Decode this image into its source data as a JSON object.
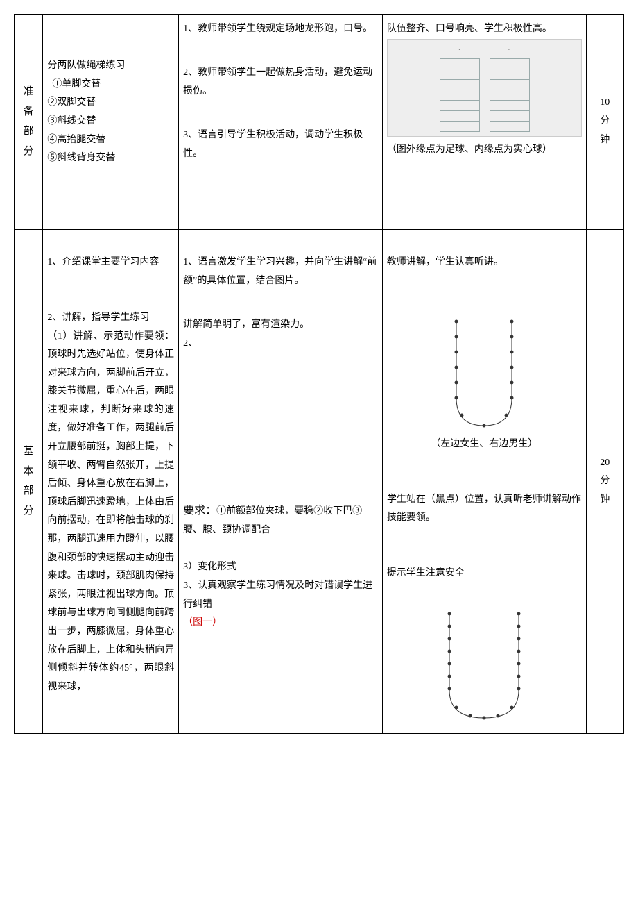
{
  "row1": {
    "label": "准备部分",
    "content_intro": "分两队做绳梯练习",
    "content_items": [
      "①单脚交替",
      "②双脚交替",
      "③斜线交替",
      "④高抬腿交替",
      "⑤斜线背身交替"
    ],
    "teacher": [
      "1、教师带领学生绕规定场地龙形跑，口号。",
      "2、教师带领学生一起做热身活动，避免运动损伤。",
      "3、语言引导学生积极活动，调动学生积极性。"
    ],
    "student_line1": "队伍整齐、口号响亮、学生积极性高。",
    "student_caption": "（图外缘点为足球、内缘点为实心球）",
    "time": [
      "10",
      "分",
      "钟"
    ]
  },
  "row2": {
    "label": "基本部分",
    "content_h1": "1、介绍课堂主要学习内容",
    "content_h2": "2、讲解，指导学生练习",
    "content_body": "（1）讲解、示范动作要领：顶球时先选好站位，使身体正对来球方向，两脚前后开立，膝关节微屈，重心在后，两眼注视来球，判断好来球的速度，做好准备工作，两腿前后开立腰部前挺，胸部上提，下颌平收、两臂自然张开，上提后倾、身体重心放在右脚上，顶球后脚迅速蹬地，上体由后向前摆动，在即将触击球的刹那，两腿迅速用力蹬伸，以腰腹和颈部的快速摆动主动迎击来球。击球时，颈部肌肉保持紧张，两眼注视出球方向。顶球前与出球方向同侧腿向前跨出一步，两膝微屈，身体重心放在后脚上，上体和头稍向异侧倾斜并转体约45°，两眼斜视来球，",
    "teacher_p1": "1、语言激发学生学习兴趣，并向学生讲解“前额”的具体位置，结合图片。",
    "teacher_p2": "讲解简单明了，富有渲染力。",
    "teacher_p2num": "2、",
    "teacher_req_label": "要求：",
    "teacher_req_body": "①前额部位夹球，要稳②收下巴③腰、膝、颈协调配合",
    "teacher_p3a": "3）变化形式",
    "teacher_p3b": "3、认真观察学生练习情况及时对错误学生进行纠错",
    "teacher_fig": "（图一）",
    "student_p1": "教师讲解，学生认真听讲。",
    "student_diag_caption": "（左边女生、右边男生）",
    "student_p2": "学生站在（黑点）位置，认真听老师讲解动作技能要领。",
    "student_p3": "提示学生注意安全",
    "time": [
      "20",
      "分",
      "钟"
    ]
  }
}
